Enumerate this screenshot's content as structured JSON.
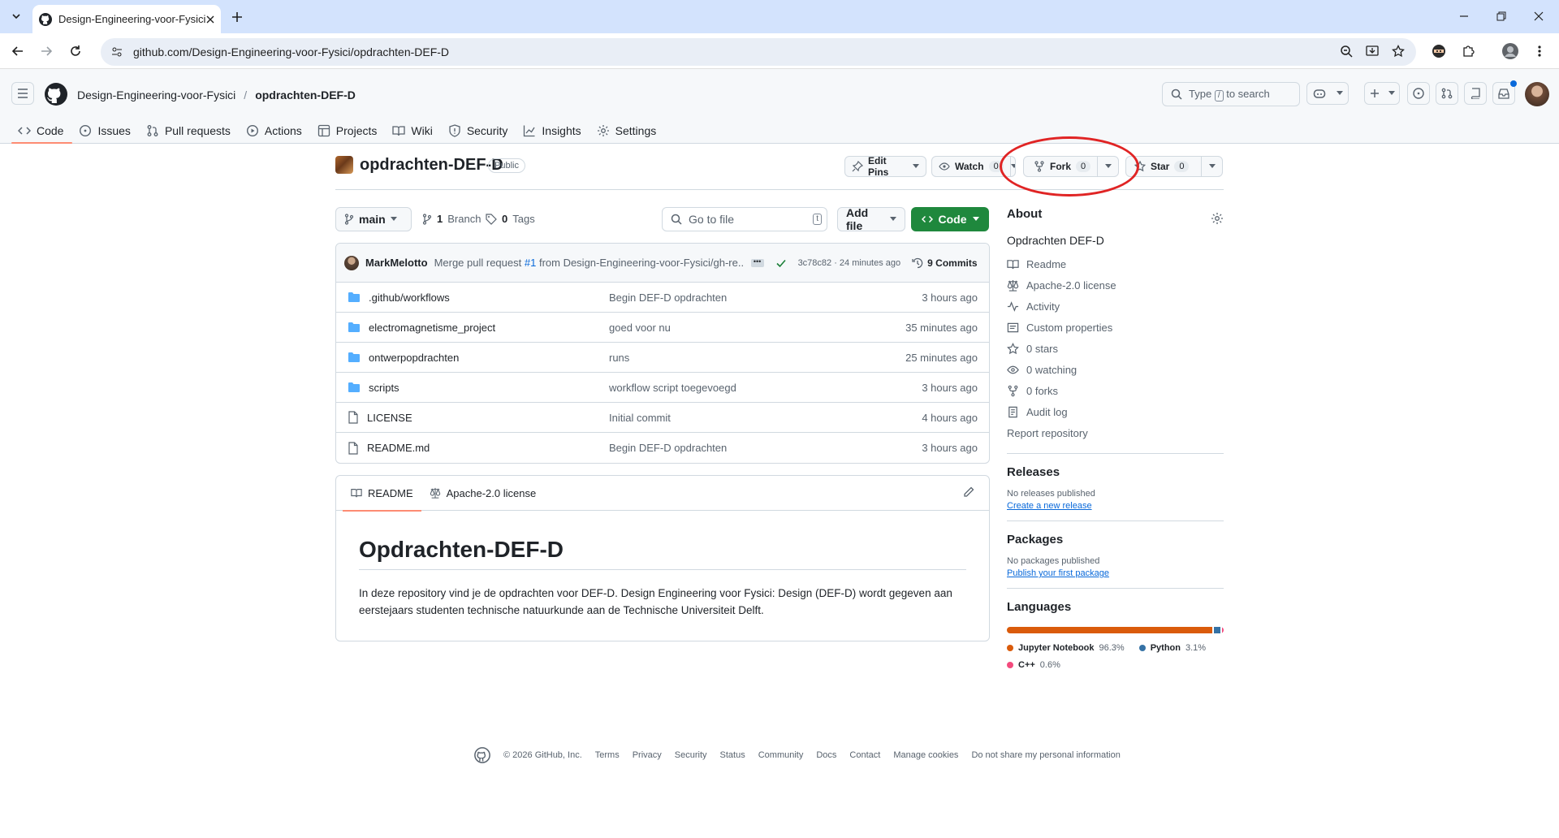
{
  "browser": {
    "tab_title": "Design-Engineering-voor-Fysici",
    "url": "github.com/Design-Engineering-voor-Fysici/opdrachten-DEF-D"
  },
  "header": {
    "owner": "Design-Engineering-voor-Fysici",
    "separator": "/",
    "repo": "opdrachten-DEF-D",
    "search_prefix": "Type",
    "search_key": "/",
    "search_suffix": "to search"
  },
  "nav": {
    "tabs": [
      {
        "label": "Code",
        "icon": "code-icon"
      },
      {
        "label": "Issues",
        "icon": "issue-icon"
      },
      {
        "label": "Pull requests",
        "icon": "pull-request-icon"
      },
      {
        "label": "Actions",
        "icon": "play-icon"
      },
      {
        "label": "Projects",
        "icon": "table-icon"
      },
      {
        "label": "Wiki",
        "icon": "book-icon"
      },
      {
        "label": "Security",
        "icon": "shield-icon"
      },
      {
        "label": "Insights",
        "icon": "graph-icon"
      },
      {
        "label": "Settings",
        "icon": "gear-icon"
      }
    ]
  },
  "repo": {
    "name": "opdrachten-DEF-D",
    "visibility": "Public",
    "edit_pins": "Edit Pins",
    "watch": "Watch",
    "watch_count": "0",
    "fork": "Fork",
    "fork_count": "0",
    "star": "Star",
    "star_count": "0"
  },
  "filenav": {
    "branch": "main",
    "branches_count": "1",
    "branches_label": "Branch",
    "tags_count": "0",
    "tags_label": "Tags",
    "goto_placeholder": "Go to file",
    "goto_key": "t",
    "add_file": "Add file",
    "code": "Code"
  },
  "commit": {
    "author": "MarkMelotto",
    "message_prefix": "Merge pull request",
    "pr": "#1",
    "message_suffix": "from Design-Engineering-voor-Fysici/gh-re...",
    "hash_time": "3c78c82 · 24 minutes ago",
    "commits": "9 Commits"
  },
  "files": [
    {
      "type": "folder",
      "name": ".github/workflows",
      "message": "Begin DEF-D opdrachten",
      "date": "3 hours ago"
    },
    {
      "type": "folder",
      "name": "electromagnetisme_project",
      "message": "goed voor nu",
      "date": "35 minutes ago"
    },
    {
      "type": "folder",
      "name": "ontwerpopdrachten",
      "message": "runs",
      "date": "25 minutes ago"
    },
    {
      "type": "folder",
      "name": "scripts",
      "message": "workflow script toegevoegd",
      "date": "3 hours ago"
    },
    {
      "type": "file",
      "name": "LICENSE",
      "message": "Initial commit",
      "date": "4 hours ago"
    },
    {
      "type": "file",
      "name": "README.md",
      "message": "Begin DEF-D opdrachten",
      "date": "3 hours ago"
    }
  ],
  "readme": {
    "tab_readme": "README",
    "tab_license": "Apache-2.0 license",
    "title": "Opdrachten-DEF-D",
    "body": "In deze repository vind je de opdrachten voor DEF-D. Design Engineering voor Fysici: Design (DEF-D) wordt gegeven aan eerstejaars studenten technische natuurkunde aan de Technische Universiteit Delft."
  },
  "about": {
    "heading": "About",
    "description": "Opdrachten DEF-D",
    "items": [
      {
        "label": "Readme",
        "icon": "book-icon"
      },
      {
        "label": "Apache-2.0 license",
        "icon": "law-icon"
      },
      {
        "label": "Activity",
        "icon": "pulse-icon"
      },
      {
        "label": "Custom properties",
        "icon": "note-icon"
      },
      {
        "label": "0 stars",
        "icon": "star-icon"
      },
      {
        "label": "0 watching",
        "icon": "eye-icon"
      },
      {
        "label": "0 forks",
        "icon": "fork-icon"
      },
      {
        "label": "Audit log",
        "icon": "log-icon"
      }
    ],
    "report": "Report repository"
  },
  "releases": {
    "heading": "Releases",
    "none": "No releases published",
    "link": "Create a new release"
  },
  "packages": {
    "heading": "Packages",
    "none": "No packages published",
    "link": "Publish your first package"
  },
  "languages": {
    "heading": "Languages",
    "items": [
      {
        "name": "Jupyter Notebook",
        "percent": "96.3%",
        "value": 96.3,
        "color": "#DA5B0B"
      },
      {
        "name": "Python",
        "percent": "3.1%",
        "value": 3.1,
        "color": "#3572A5"
      },
      {
        "name": "C++",
        "percent": "0.6%",
        "value": 0.6,
        "color": "#f34b7d"
      }
    ]
  },
  "footer": {
    "copyright": "© 2026 GitHub, Inc.",
    "links": [
      "Terms",
      "Privacy",
      "Security",
      "Status",
      "Community",
      "Docs",
      "Contact",
      "Manage cookies",
      "Do not share my personal information"
    ]
  },
  "colors": {
    "accent_green": "#1f883d",
    "link": "#0969da",
    "highlight_circle": "#e02424"
  }
}
